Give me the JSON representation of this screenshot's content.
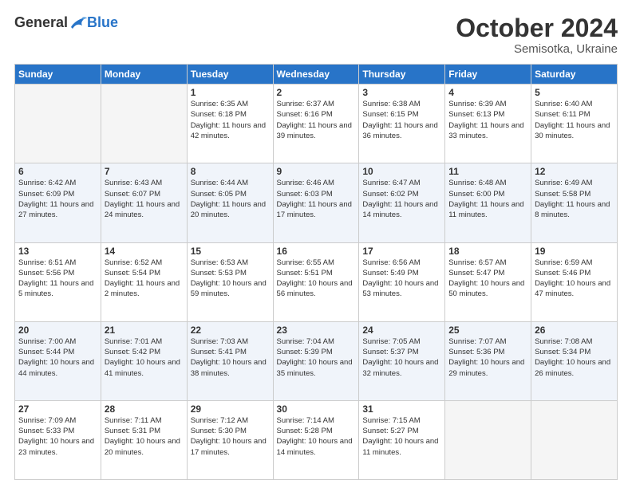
{
  "header": {
    "logo_general": "General",
    "logo_blue": "Blue",
    "main_title": "October 2024",
    "subtitle": "Semisotka, Ukraine"
  },
  "days_of_week": [
    "Sunday",
    "Monday",
    "Tuesday",
    "Wednesday",
    "Thursday",
    "Friday",
    "Saturday"
  ],
  "weeks": [
    {
      "shaded": false,
      "days": [
        {
          "num": "",
          "info": ""
        },
        {
          "num": "",
          "info": ""
        },
        {
          "num": "1",
          "info": "Sunrise: 6:35 AM\nSunset: 6:18 PM\nDaylight: 11 hours and 42 minutes."
        },
        {
          "num": "2",
          "info": "Sunrise: 6:37 AM\nSunset: 6:16 PM\nDaylight: 11 hours and 39 minutes."
        },
        {
          "num": "3",
          "info": "Sunrise: 6:38 AM\nSunset: 6:15 PM\nDaylight: 11 hours and 36 minutes."
        },
        {
          "num": "4",
          "info": "Sunrise: 6:39 AM\nSunset: 6:13 PM\nDaylight: 11 hours and 33 minutes."
        },
        {
          "num": "5",
          "info": "Sunrise: 6:40 AM\nSunset: 6:11 PM\nDaylight: 11 hours and 30 minutes."
        }
      ]
    },
    {
      "shaded": true,
      "days": [
        {
          "num": "6",
          "info": "Sunrise: 6:42 AM\nSunset: 6:09 PM\nDaylight: 11 hours and 27 minutes."
        },
        {
          "num": "7",
          "info": "Sunrise: 6:43 AM\nSunset: 6:07 PM\nDaylight: 11 hours and 24 minutes."
        },
        {
          "num": "8",
          "info": "Sunrise: 6:44 AM\nSunset: 6:05 PM\nDaylight: 11 hours and 20 minutes."
        },
        {
          "num": "9",
          "info": "Sunrise: 6:46 AM\nSunset: 6:03 PM\nDaylight: 11 hours and 17 minutes."
        },
        {
          "num": "10",
          "info": "Sunrise: 6:47 AM\nSunset: 6:02 PM\nDaylight: 11 hours and 14 minutes."
        },
        {
          "num": "11",
          "info": "Sunrise: 6:48 AM\nSunset: 6:00 PM\nDaylight: 11 hours and 11 minutes."
        },
        {
          "num": "12",
          "info": "Sunrise: 6:49 AM\nSunset: 5:58 PM\nDaylight: 11 hours and 8 minutes."
        }
      ]
    },
    {
      "shaded": false,
      "days": [
        {
          "num": "13",
          "info": "Sunrise: 6:51 AM\nSunset: 5:56 PM\nDaylight: 11 hours and 5 minutes."
        },
        {
          "num": "14",
          "info": "Sunrise: 6:52 AM\nSunset: 5:54 PM\nDaylight: 11 hours and 2 minutes."
        },
        {
          "num": "15",
          "info": "Sunrise: 6:53 AM\nSunset: 5:53 PM\nDaylight: 10 hours and 59 minutes."
        },
        {
          "num": "16",
          "info": "Sunrise: 6:55 AM\nSunset: 5:51 PM\nDaylight: 10 hours and 56 minutes."
        },
        {
          "num": "17",
          "info": "Sunrise: 6:56 AM\nSunset: 5:49 PM\nDaylight: 10 hours and 53 minutes."
        },
        {
          "num": "18",
          "info": "Sunrise: 6:57 AM\nSunset: 5:47 PM\nDaylight: 10 hours and 50 minutes."
        },
        {
          "num": "19",
          "info": "Sunrise: 6:59 AM\nSunset: 5:46 PM\nDaylight: 10 hours and 47 minutes."
        }
      ]
    },
    {
      "shaded": true,
      "days": [
        {
          "num": "20",
          "info": "Sunrise: 7:00 AM\nSunset: 5:44 PM\nDaylight: 10 hours and 44 minutes."
        },
        {
          "num": "21",
          "info": "Sunrise: 7:01 AM\nSunset: 5:42 PM\nDaylight: 10 hours and 41 minutes."
        },
        {
          "num": "22",
          "info": "Sunrise: 7:03 AM\nSunset: 5:41 PM\nDaylight: 10 hours and 38 minutes."
        },
        {
          "num": "23",
          "info": "Sunrise: 7:04 AM\nSunset: 5:39 PM\nDaylight: 10 hours and 35 minutes."
        },
        {
          "num": "24",
          "info": "Sunrise: 7:05 AM\nSunset: 5:37 PM\nDaylight: 10 hours and 32 minutes."
        },
        {
          "num": "25",
          "info": "Sunrise: 7:07 AM\nSunset: 5:36 PM\nDaylight: 10 hours and 29 minutes."
        },
        {
          "num": "26",
          "info": "Sunrise: 7:08 AM\nSunset: 5:34 PM\nDaylight: 10 hours and 26 minutes."
        }
      ]
    },
    {
      "shaded": false,
      "days": [
        {
          "num": "27",
          "info": "Sunrise: 7:09 AM\nSunset: 5:33 PM\nDaylight: 10 hours and 23 minutes."
        },
        {
          "num": "28",
          "info": "Sunrise: 7:11 AM\nSunset: 5:31 PM\nDaylight: 10 hours and 20 minutes."
        },
        {
          "num": "29",
          "info": "Sunrise: 7:12 AM\nSunset: 5:30 PM\nDaylight: 10 hours and 17 minutes."
        },
        {
          "num": "30",
          "info": "Sunrise: 7:14 AM\nSunset: 5:28 PM\nDaylight: 10 hours and 14 minutes."
        },
        {
          "num": "31",
          "info": "Sunrise: 7:15 AM\nSunset: 5:27 PM\nDaylight: 10 hours and 11 minutes."
        },
        {
          "num": "",
          "info": ""
        },
        {
          "num": "",
          "info": ""
        }
      ]
    }
  ]
}
